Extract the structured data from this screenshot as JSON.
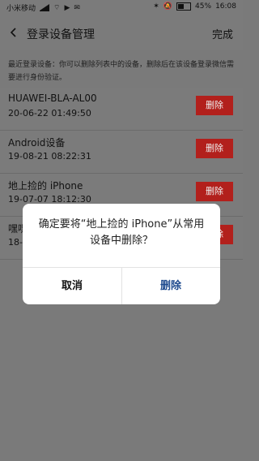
{
  "status": {
    "carrier": "小米移动",
    "battery": "45%",
    "time": "16:08"
  },
  "nav": {
    "title": "登录设备管理",
    "done": "完成"
  },
  "tip": "最近登录设备：你可以删除列表中的设备，删除后在该设备登录微信需要进行身份验证。",
  "devices": [
    {
      "name": "HUAWEI-BLA-AL00",
      "time": "20-06-22 01:49:50",
      "action": "删除"
    },
    {
      "name": "Android设备",
      "time": "19-08-21 08:22:31",
      "action": "删除"
    },
    {
      "name": "地上捡的 iPhone",
      "time": "19-07-07 18:12:30",
      "action": "删除"
    },
    {
      "name": "嘿嘿",
      "time": "18-",
      "action": "删除"
    }
  ],
  "dialog": {
    "message": "确定要将“地上捡的 iPhone”从常用设备中删除？",
    "cancel": "取消",
    "confirm": "删除"
  }
}
